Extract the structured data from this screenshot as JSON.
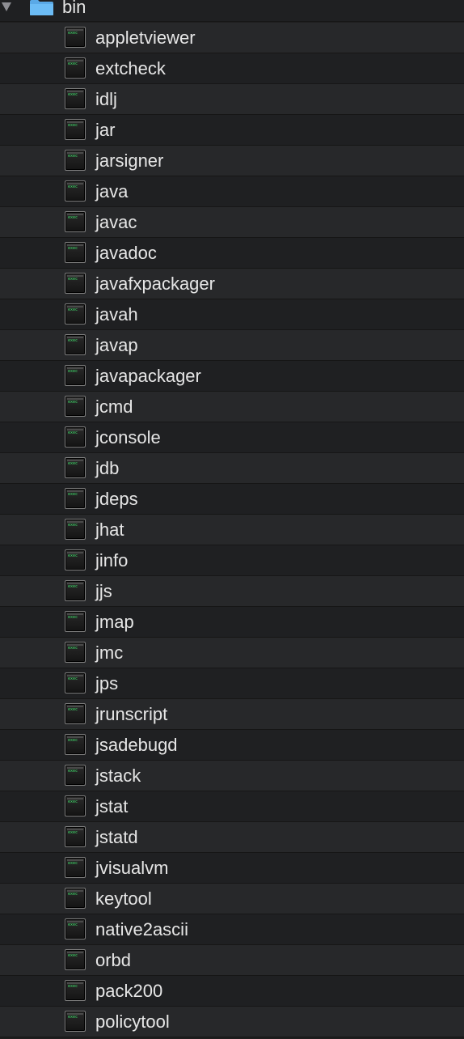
{
  "folder": {
    "name": "bin",
    "expanded": true,
    "icon": "folder-icon",
    "color": "#5fb6f2"
  },
  "exec_icon": {
    "name": "unix-executable-icon",
    "prompt_text": "exec"
  },
  "colors": {
    "background": "#1e1e1e",
    "row_even": "#1f2022",
    "row_odd": "#27282a",
    "text": "#e6e6e6",
    "prompt_green": "#3fe06a"
  },
  "files": [
    "appletviewer",
    "extcheck",
    "idlj",
    "jar",
    "jarsigner",
    "java",
    "javac",
    "javadoc",
    "javafxpackager",
    "javah",
    "javap",
    "javapackager",
    "jcmd",
    "jconsole",
    "jdb",
    "jdeps",
    "jhat",
    "jinfo",
    "jjs",
    "jmap",
    "jmc",
    "jps",
    "jrunscript",
    "jsadebugd",
    "jstack",
    "jstat",
    "jstatd",
    "jvisualvm",
    "keytool",
    "native2ascii",
    "orbd",
    "pack200",
    "policytool"
  ]
}
